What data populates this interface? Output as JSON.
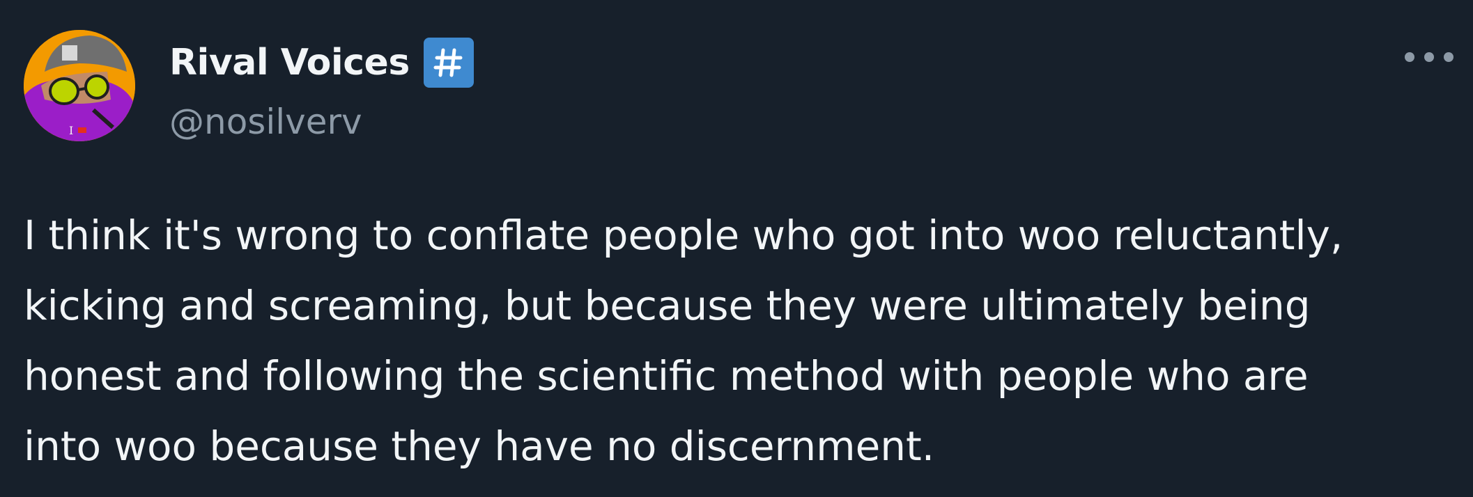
{
  "author": {
    "display_name": "Rival Voices",
    "handle": "@nosilverv",
    "badge_symbol": "#",
    "badge_color": "#3f8ad0"
  },
  "menu": {
    "icon": "more-horizontal-icon"
  },
  "tweet": {
    "lines": [
      "I think it's wrong to conflate people who got into woo reluctantly,",
      "kicking and screaming, but because they were ultimately being",
      "honest and following the scientific method with people who are",
      "into woo because they have no discernment."
    ]
  },
  "colors": {
    "background": "#17202b",
    "text": "#f2f5f7",
    "secondary_text": "#8d9aa7"
  }
}
